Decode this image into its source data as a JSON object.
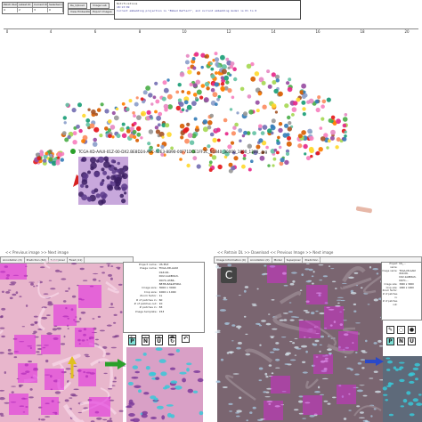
{
  "top_table": {
    "headers": [
      "Patch Number",
      "Latest ID",
      "Current ID",
      "Selected ID"
    ],
    "row": [
      "4",
      "2",
      "3",
      "0"
    ],
    "buttons": [
      "Re_Upload",
      "Image Lab",
      "View Embedding",
      "Export Images"
    ]
  },
  "console": {
    "header": "Notifications",
    "lines": [
      "18:13:09",
      "Current embedding projection is \"Embed Reflect\", and current embedding model is Dl to 0"
    ]
  },
  "axis_ticks": [
    "0",
    "4",
    "6",
    "8",
    "10",
    "12",
    "14",
    "16",
    "18",
    "20"
  ],
  "embedding": {
    "highlight_label": "TCGA-XD-AAUI-01Z-00-DX2.BE8D24-A6C-42E3-8B90-00F71DCE1FF2C_81840_30000_1800_1200_.jpg",
    "arrow_color": "#d62020",
    "highlight_color": "#2aa02a"
  },
  "left_panel": {
    "nav": "<< Previous image   >> Next image",
    "tabs": [
      "Annotation (0)",
      "Prediction (60)",
      "Superpixel",
      "Fixed (11)"
    ],
    "info": [
      {
        "k": "Project name:",
        "v": "US Plot"
      },
      {
        "k": "Image name:",
        "v": "TCGA-XD-AAUI"
      },
      {
        "k": "",
        "v": "01Z-00-"
      },
      {
        "k": "",
        "v": "DX2.1A0B3A3-"
      },
      {
        "k": "",
        "v": "D07C-4384-"
      },
      {
        "k": "",
        "v": "887B-8A9AF0DA"
      },
      {
        "k": "Image size:",
        "v": "3000 x 3000"
      },
      {
        "k": "Crop size:",
        "v": "1000 x 1000"
      },
      {
        "k": "Zoom factor:",
        "v": "1x"
      },
      {
        "k": "# of patches in:",
        "v": "60"
      },
      {
        "k": "# of patches out:",
        "v": "10"
      },
      {
        "k": "# patches in:",
        "v": "83"
      },
      {
        "k": "Image template:",
        "v": "153"
      }
    ],
    "tools": [
      "P",
      "N",
      "U"
    ]
  },
  "right_panel": {
    "label": "C",
    "nav": "<< Retrain DL   >> Download   << Previous Image   >> Next image",
    "tabs": [
      "Image Information (0)",
      "Annotation (0)",
      "Model",
      "Superpixel",
      "Prediction"
    ],
    "info": [
      {
        "k": "Project name:",
        "v": "US_..."
      },
      {
        "k": "Image name:",
        "v": "TCGA-XD-AAUI"
      },
      {
        "k": "",
        "v": "01Z-00-"
      },
      {
        "k": "",
        "v": "DX2.1A0B3A3-"
      },
      {
        "k": "",
        "v": "D07C-..."
      },
      {
        "k": "Image size:",
        "v": "3000 x 3000"
      },
      {
        "k": "Crop size:",
        "v": "1000 x 1000"
      },
      {
        "k": "Zoom factor:",
        "v": ""
      },
      {
        "k": "# of patches in:",
        "v": ""
      },
      {
        "k": "# of patches out:",
        "v": ""
      }
    ],
    "tools": [
      "P",
      "N",
      "U"
    ]
  },
  "colors": {
    "accent": "#e020e0",
    "tissue": "#e6a8c8",
    "nav_blue": "#2a49c8"
  }
}
